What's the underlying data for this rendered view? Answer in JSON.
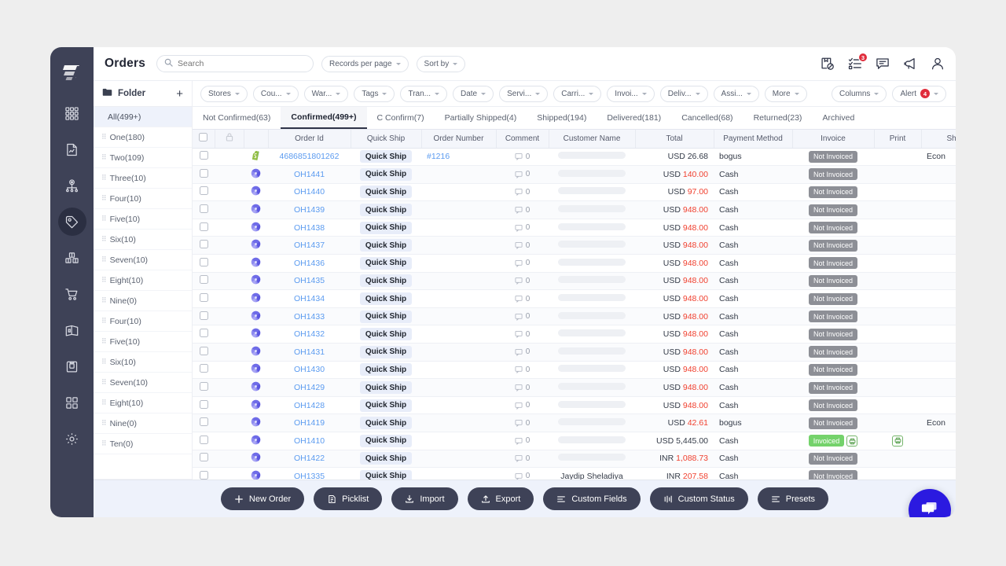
{
  "header": {
    "title": "Orders",
    "search_placeholder": "Search",
    "records_per_page": "Records per page",
    "sort_by": "Sort by",
    "icons": [
      {
        "name": "package-cancel-icon"
      },
      {
        "name": "task-list-icon",
        "badge": "3"
      },
      {
        "name": "chat-icon"
      },
      {
        "name": "megaphone-icon"
      },
      {
        "name": "user-account-icon"
      }
    ]
  },
  "filterbar": {
    "folder_label": "Folder",
    "add_label": "+",
    "chips": [
      "Stores",
      "Cou...",
      "War...",
      "Tags",
      "Tran...",
      "Date",
      "Servi...",
      "Carri...",
      "Invoi...",
      "Deliv...",
      "Assi...",
      "More"
    ],
    "right_chips": [
      {
        "label": "Columns"
      },
      {
        "label": "Alert",
        "badge": "4"
      }
    ]
  },
  "folders": [
    {
      "label": "All(499+)",
      "active": true
    },
    {
      "label": "One(180)"
    },
    {
      "label": "Two(109)"
    },
    {
      "label": "Three(10)"
    },
    {
      "label": "Four(10)"
    },
    {
      "label": "Five(10)"
    },
    {
      "label": "Six(10)"
    },
    {
      "label": "Seven(10)"
    },
    {
      "label": "Eight(10)"
    },
    {
      "label": "Nine(0)"
    },
    {
      "label": "Four(10)"
    },
    {
      "label": "Five(10)"
    },
    {
      "label": "Six(10)"
    },
    {
      "label": "Seven(10)"
    },
    {
      "label": "Eight(10)"
    },
    {
      "label": "Nine(0)"
    },
    {
      "label": "Ten(0)"
    }
  ],
  "tabs": [
    {
      "label": "Not Confirmed(63)",
      "active": false
    },
    {
      "label": "Confirmed(499+)",
      "active": true
    },
    {
      "label": "C Confirm(7)",
      "active": false
    },
    {
      "label": "Partially Shipped(4)",
      "active": false
    },
    {
      "label": "Shipped(194)",
      "active": false
    },
    {
      "label": "Delivered(181)",
      "active": false
    },
    {
      "label": "Cancelled(68)",
      "active": false
    },
    {
      "label": "Returned(23)",
      "active": false
    },
    {
      "label": "Archived",
      "active": false
    }
  ],
  "table": {
    "columns": [
      "",
      "",
      "",
      "Order Id",
      "Quick Ship",
      "Order Number",
      "Comment",
      "Customer Name",
      "Total",
      "Payment Method",
      "Invoice",
      "Print",
      "Ship"
    ],
    "quick_ship_label": "Quick Ship",
    "rows": [
      {
        "channel": "shopify",
        "order_id": "4686851801262",
        "order_number": "#1216",
        "comment": "0",
        "customer": "",
        "total_currency": "USD",
        "total_amount": "26.68",
        "total_red": false,
        "payment": "bogus",
        "invoice": "Not Invoiced",
        "invoiced": false,
        "print": false,
        "ship": "Econ"
      },
      {
        "channel": "other",
        "order_id": "OH1441",
        "order_number": "",
        "comment": "0",
        "customer": "",
        "total_currency": "USD",
        "total_amount": "140.00",
        "total_red": true,
        "payment": "Cash",
        "invoice": "Not Invoiced",
        "invoiced": false,
        "print": false,
        "ship": ""
      },
      {
        "channel": "other",
        "order_id": "OH1440",
        "order_number": "",
        "comment": "0",
        "customer": "",
        "total_currency": "USD",
        "total_amount": "97.00",
        "total_red": true,
        "payment": "Cash",
        "invoice": "Not Invoiced",
        "invoiced": false,
        "print": false,
        "ship": ""
      },
      {
        "channel": "other",
        "order_id": "OH1439",
        "order_number": "",
        "comment": "0",
        "customer": "",
        "total_currency": "USD",
        "total_amount": "948.00",
        "total_red": true,
        "payment": "Cash",
        "invoice": "Not Invoiced",
        "invoiced": false,
        "print": false,
        "ship": ""
      },
      {
        "channel": "other",
        "order_id": "OH1438",
        "order_number": "",
        "comment": "0",
        "customer": "",
        "total_currency": "USD",
        "total_amount": "948.00",
        "total_red": true,
        "payment": "Cash",
        "invoice": "Not Invoiced",
        "invoiced": false,
        "print": false,
        "ship": ""
      },
      {
        "channel": "other",
        "order_id": "OH1437",
        "order_number": "",
        "comment": "0",
        "customer": "",
        "total_currency": "USD",
        "total_amount": "948.00",
        "total_red": true,
        "payment": "Cash",
        "invoice": "Not Invoiced",
        "invoiced": false,
        "print": false,
        "ship": ""
      },
      {
        "channel": "other",
        "order_id": "OH1436",
        "order_number": "",
        "comment": "0",
        "customer": "",
        "total_currency": "USD",
        "total_amount": "948.00",
        "total_red": true,
        "payment": "Cash",
        "invoice": "Not Invoiced",
        "invoiced": false,
        "print": false,
        "ship": ""
      },
      {
        "channel": "other",
        "order_id": "OH1435",
        "order_number": "",
        "comment": "0",
        "customer": "",
        "total_currency": "USD",
        "total_amount": "948.00",
        "total_red": true,
        "payment": "Cash",
        "invoice": "Not Invoiced",
        "invoiced": false,
        "print": false,
        "ship": ""
      },
      {
        "channel": "other",
        "order_id": "OH1434",
        "order_number": "",
        "comment": "0",
        "customer": "",
        "total_currency": "USD",
        "total_amount": "948.00",
        "total_red": true,
        "payment": "Cash",
        "invoice": "Not Invoiced",
        "invoiced": false,
        "print": false,
        "ship": ""
      },
      {
        "channel": "other",
        "order_id": "OH1433",
        "order_number": "",
        "comment": "0",
        "customer": "",
        "total_currency": "USD",
        "total_amount": "948.00",
        "total_red": true,
        "payment": "Cash",
        "invoice": "Not Invoiced",
        "invoiced": false,
        "print": false,
        "ship": ""
      },
      {
        "channel": "other",
        "order_id": "OH1432",
        "order_number": "",
        "comment": "0",
        "customer": "",
        "total_currency": "USD",
        "total_amount": "948.00",
        "total_red": true,
        "payment": "Cash",
        "invoice": "Not Invoiced",
        "invoiced": false,
        "print": false,
        "ship": ""
      },
      {
        "channel": "other",
        "order_id": "OH1431",
        "order_number": "",
        "comment": "0",
        "customer": "",
        "total_currency": "USD",
        "total_amount": "948.00",
        "total_red": true,
        "payment": "Cash",
        "invoice": "Not Invoiced",
        "invoiced": false,
        "print": false,
        "ship": ""
      },
      {
        "channel": "other",
        "order_id": "OH1430",
        "order_number": "",
        "comment": "0",
        "customer": "",
        "total_currency": "USD",
        "total_amount": "948.00",
        "total_red": true,
        "payment": "Cash",
        "invoice": "Not Invoiced",
        "invoiced": false,
        "print": false,
        "ship": ""
      },
      {
        "channel": "other",
        "order_id": "OH1429",
        "order_number": "",
        "comment": "0",
        "customer": "",
        "total_currency": "USD",
        "total_amount": "948.00",
        "total_red": true,
        "payment": "Cash",
        "invoice": "Not Invoiced",
        "invoiced": false,
        "print": false,
        "ship": ""
      },
      {
        "channel": "other",
        "order_id": "OH1428",
        "order_number": "",
        "comment": "0",
        "customer": "",
        "total_currency": "USD",
        "total_amount": "948.00",
        "total_red": true,
        "payment": "Cash",
        "invoice": "Not Invoiced",
        "invoiced": false,
        "print": false,
        "ship": ""
      },
      {
        "channel": "other",
        "order_id": "OH1419",
        "order_number": "",
        "comment": "0",
        "customer": "",
        "total_currency": "USD",
        "total_amount": "42.61",
        "total_red": true,
        "payment": "bogus",
        "invoice": "Not Invoiced",
        "invoiced": false,
        "print": false,
        "ship": "Econ"
      },
      {
        "channel": "other",
        "order_id": "OH1410",
        "order_number": "",
        "comment": "0",
        "customer": "",
        "total_currency": "USD",
        "total_amount": "5,445.00",
        "total_red": false,
        "payment": "Cash",
        "invoice": "Invoiced",
        "invoiced": true,
        "print": true,
        "ship": ""
      },
      {
        "channel": "other",
        "order_id": "OH1422",
        "order_number": "",
        "comment": "0",
        "customer": "",
        "total_currency": "INR",
        "total_amount": "1,088.73",
        "total_red": true,
        "payment": "Cash",
        "invoice": "Not Invoiced",
        "invoiced": false,
        "print": false,
        "ship": ""
      },
      {
        "channel": "other",
        "order_id": "OH1335",
        "order_number": "",
        "comment": "0",
        "customer": "Jaydip Sheladiya",
        "total_currency": "INR",
        "total_amount": "207.58",
        "total_red": true,
        "payment": "Cash",
        "invoice": "Not Invoiced",
        "invoiced": false,
        "print": false,
        "ship": ""
      }
    ]
  },
  "bottom_toolbar": [
    {
      "label": "New Order",
      "icon": "plus-icon"
    },
    {
      "label": "Picklist",
      "icon": "picklist-icon"
    },
    {
      "label": "Import",
      "icon": "import-icon"
    },
    {
      "label": "Export",
      "icon": "export-icon"
    },
    {
      "label": "Custom Fields",
      "icon": "fields-icon"
    },
    {
      "label": "Custom Status",
      "icon": "status-icon"
    },
    {
      "label": "Presets",
      "icon": "presets-icon"
    }
  ],
  "chat_fab": {
    "name": "chat-bubble-icon"
  },
  "colors": {
    "rail_bg": "#3e4257",
    "accent_blue": "#5b9bf0",
    "danger_red": "#e02d3c",
    "amount_red": "#f0402f",
    "invoiced_green": "#74d26b",
    "not_invoiced_gray": "#8d8f96",
    "chat_purple": "#2b1ae0",
    "panel_bg": "#eef2fb"
  }
}
